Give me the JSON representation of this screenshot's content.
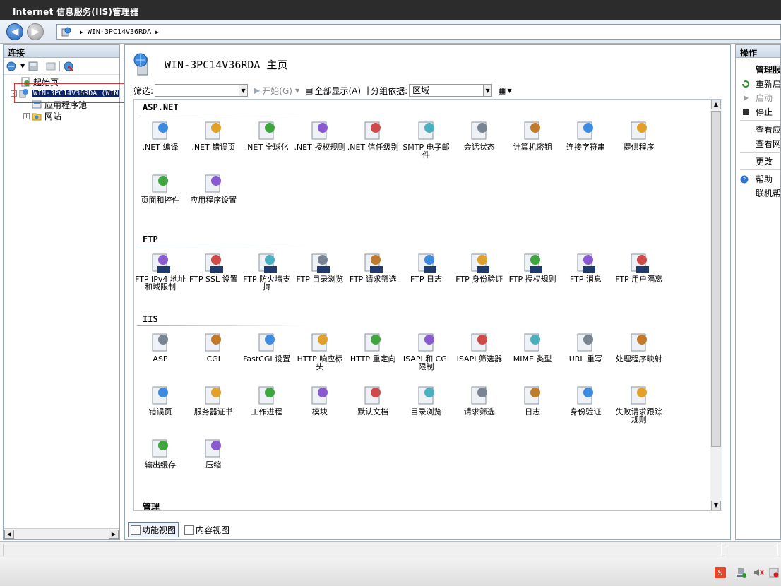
{
  "window": {
    "title": "Internet 信息服务(IIS)管理器"
  },
  "address": {
    "path": "WIN-3PC14V36RDA"
  },
  "connections": {
    "header": "连接",
    "tree": {
      "start_page": "起始页",
      "server": "WIN-3PC14V36RDA (WIN",
      "app_pools": "应用程序池",
      "sites": "网站"
    }
  },
  "home": {
    "title": "WIN-3PC14V36RDA 主页"
  },
  "filter": {
    "label": "筛选:",
    "start": "开始(G)",
    "show_all": "全部显示(A)",
    "group_by": "分组依据:",
    "group_value": "区域"
  },
  "groups": [
    {
      "title": "ASP.NET",
      "items": [
        {
          "label": ".NET 编译",
          "icon": "net-compile-icon"
        },
        {
          "label": ".NET 错误页",
          "icon": "error-page-icon"
        },
        {
          "label": ".NET 全球化",
          "icon": "globe-icon"
        },
        {
          "label": ".NET 授权规则",
          "icon": "authorization-icon"
        },
        {
          "label": ".NET 信任级别",
          "icon": "trust-level-icon"
        },
        {
          "label": "SMTP 电子邮件",
          "icon": "smtp-email-icon"
        },
        {
          "label": "会话状态",
          "icon": "session-state-icon"
        },
        {
          "label": "计算机密钥",
          "icon": "machine-key-icon"
        },
        {
          "label": "连接字符串",
          "icon": "connection-string-icon"
        },
        {
          "label": "提供程序",
          "icon": "providers-icon"
        },
        {
          "label": "页面和控件",
          "icon": "pages-controls-icon"
        },
        {
          "label": "应用程序设置",
          "icon": "app-settings-icon"
        }
      ]
    },
    {
      "title": "FTP",
      "items": [
        {
          "label": "FTP IPv4 地址和域限制",
          "icon": "ftp-ipv4-icon"
        },
        {
          "label": "FTP SSL 设置",
          "icon": "ftp-ssl-icon"
        },
        {
          "label": "FTP 防火墙支持",
          "icon": "ftp-firewall-icon"
        },
        {
          "label": "FTP 目录浏览",
          "icon": "ftp-directory-icon"
        },
        {
          "label": "FTP 请求筛选",
          "icon": "ftp-request-filter-icon"
        },
        {
          "label": "FTP 日志",
          "icon": "ftp-log-icon"
        },
        {
          "label": "FTP 身份验证",
          "icon": "ftp-auth-icon"
        },
        {
          "label": "FTP 授权规则",
          "icon": "ftp-authorization-icon"
        },
        {
          "label": "FTP 消息",
          "icon": "ftp-message-icon"
        },
        {
          "label": "FTP 用户隔离",
          "icon": "ftp-user-isolation-icon"
        }
      ]
    },
    {
      "title": "IIS",
      "items": [
        {
          "label": "ASP",
          "icon": "asp-icon"
        },
        {
          "label": "CGI",
          "icon": "cgi-icon"
        },
        {
          "label": "FastCGI 设置",
          "icon": "fastcgi-icon"
        },
        {
          "label": "HTTP 响应标头",
          "icon": "http-headers-icon"
        },
        {
          "label": "HTTP 重定向",
          "icon": "http-redirect-icon"
        },
        {
          "label": "ISAPI 和 CGI 限制",
          "icon": "isapi-cgi-icon"
        },
        {
          "label": "ISAPI 筛选器",
          "icon": "isapi-filter-icon"
        },
        {
          "label": "MIME 类型",
          "icon": "mime-icon"
        },
        {
          "label": "URL 重写",
          "icon": "url-rewrite-icon"
        },
        {
          "label": "处理程序映射",
          "icon": "handler-mapping-icon"
        },
        {
          "label": "错误页",
          "icon": "error-page-icon"
        },
        {
          "label": "服务器证书",
          "icon": "certificate-icon"
        },
        {
          "label": "工作进程",
          "icon": "worker-process-icon"
        },
        {
          "label": "模块",
          "icon": "modules-icon"
        },
        {
          "label": "默认文档",
          "icon": "default-document-icon"
        },
        {
          "label": "目录浏览",
          "icon": "directory-browsing-icon"
        },
        {
          "label": "请求筛选",
          "icon": "request-filter-icon"
        },
        {
          "label": "日志",
          "icon": "logging-icon"
        },
        {
          "label": "身份验证",
          "icon": "authentication-icon"
        },
        {
          "label": "失败请求跟踪规则",
          "icon": "failed-request-icon"
        },
        {
          "label": "输出缓存",
          "icon": "output-cache-icon"
        },
        {
          "label": "压缩",
          "icon": "compression-icon"
        }
      ]
    },
    {
      "title": "管理",
      "items": []
    }
  ],
  "view_tabs": {
    "features": "功能视图",
    "content": "内容视图"
  },
  "actions": {
    "header": "操作",
    "manage_server": "管理服",
    "restart": "重新启",
    "start": "启动",
    "stop": "停止",
    "view_app_pools": "查看应",
    "view_sites": "查看网",
    "change": "更改",
    "help": "帮助",
    "online_help": "联机帮"
  }
}
